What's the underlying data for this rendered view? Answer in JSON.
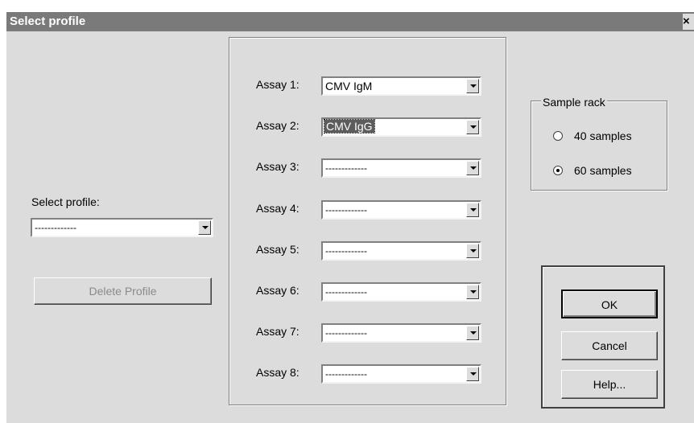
{
  "window": {
    "title": "Select profile",
    "close_glyph": "×"
  },
  "profile": {
    "label": "Select profile:",
    "value": "-------------",
    "delete_button": "Delete Profile"
  },
  "assays": [
    {
      "label": "Assay 1:",
      "value": "CMV IgM"
    },
    {
      "label": "Assay 2:",
      "value": "CMV IgG",
      "selected": true
    },
    {
      "label": "Assay 3:",
      "value": "-------------"
    },
    {
      "label": "Assay 4:",
      "value": "-------------"
    },
    {
      "label": "Assay 5:",
      "value": "-------------"
    },
    {
      "label": "Assay 6:",
      "value": "-------------"
    },
    {
      "label": "Assay 7:",
      "value": "-------------"
    },
    {
      "label": "Assay 8:",
      "value": "-------------"
    }
  ],
  "sample_rack": {
    "title": "Sample rack",
    "options": [
      {
        "label": "40 samples",
        "checked": false
      },
      {
        "label": "60 samples",
        "checked": true
      }
    ]
  },
  "buttons": {
    "ok": "OK",
    "cancel": "Cancel",
    "help": "Help..."
  },
  "icons": {
    "dropdown": "chevron-down-icon",
    "close": "close-icon"
  }
}
